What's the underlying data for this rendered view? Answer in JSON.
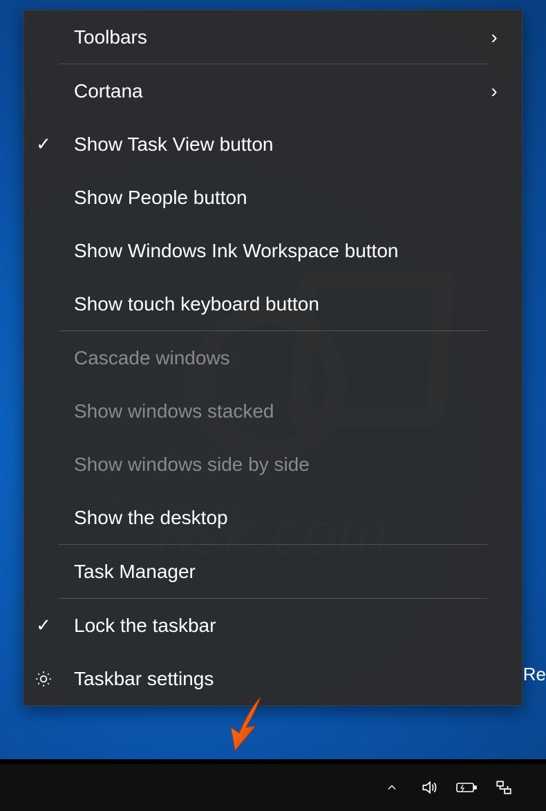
{
  "menu": {
    "toolbars": "Toolbars",
    "cortana": "Cortana",
    "show_task_view": "Show Task View button",
    "show_people": "Show People button",
    "show_ink": "Show Windows Ink Workspace button",
    "show_touch_kb": "Show touch keyboard button",
    "cascade": "Cascade windows",
    "stacked": "Show windows stacked",
    "side_by_side": "Show windows side by side",
    "show_desktop": "Show the desktop",
    "task_manager": "Task Manager",
    "lock_taskbar": "Lock the taskbar",
    "taskbar_settings": "Taskbar settings"
  },
  "watermark": {
    "text": "risk.com"
  },
  "tray": {
    "notification_fragment": "Re"
  },
  "glyphs": {
    "check": "✓",
    "chevron_right": "›"
  }
}
